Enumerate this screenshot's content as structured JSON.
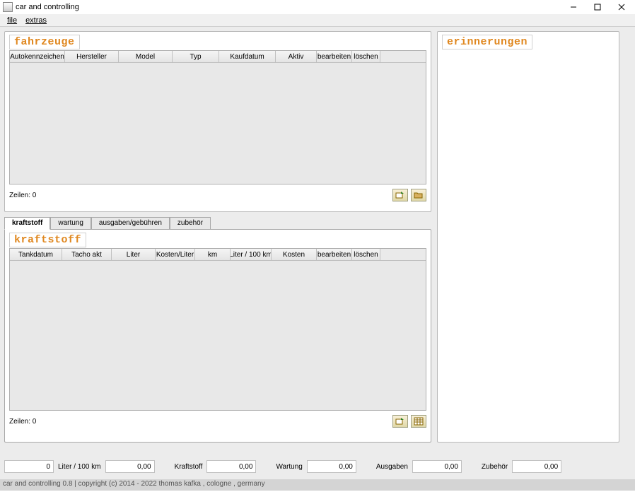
{
  "window": {
    "title": "car and controlling"
  },
  "menubar": {
    "file": "file",
    "extras": "extras"
  },
  "vehicles": {
    "title": "fahrzeuge",
    "columns": [
      "Autokennzeichen",
      "Hersteller",
      "Model",
      "Typ",
      "Kaufdatum",
      "Aktiv",
      "bearbeiten",
      "löschen"
    ],
    "rows_label": "Zeilen: 0"
  },
  "reminders": {
    "title": "erinnerungen"
  },
  "tabs": {
    "items": [
      "kraftstoff",
      "wartung",
      "ausgaben/gebühren",
      "zubehör"
    ],
    "active_index": 0
  },
  "fuel": {
    "title": "kraftstoff",
    "columns": [
      "Tankdatum",
      "Tacho akt",
      "Liter",
      "Kosten/Liter",
      "km",
      "Liter / 100 km",
      "Kosten",
      "bearbeiten",
      "löschen"
    ],
    "rows_label": "Zeilen: 0"
  },
  "status": {
    "field0": "0",
    "liter_100km_label": "Liter / 100 km",
    "liter_100km_value": "0,00",
    "kraftstoff_label": "Kraftstoff",
    "kraftstoff_value": "0,00",
    "wartung_label": "Wartung",
    "wartung_value": "0,00",
    "ausgaben_label": "Ausgaben",
    "ausgaben_value": "0,00",
    "zubehor_label": "Zubehör",
    "zubehor_value": "0,00"
  },
  "footer": "car and controlling 0.8 | copyright (c) 2014 - 2022 thomas kafka , cologne , germany"
}
